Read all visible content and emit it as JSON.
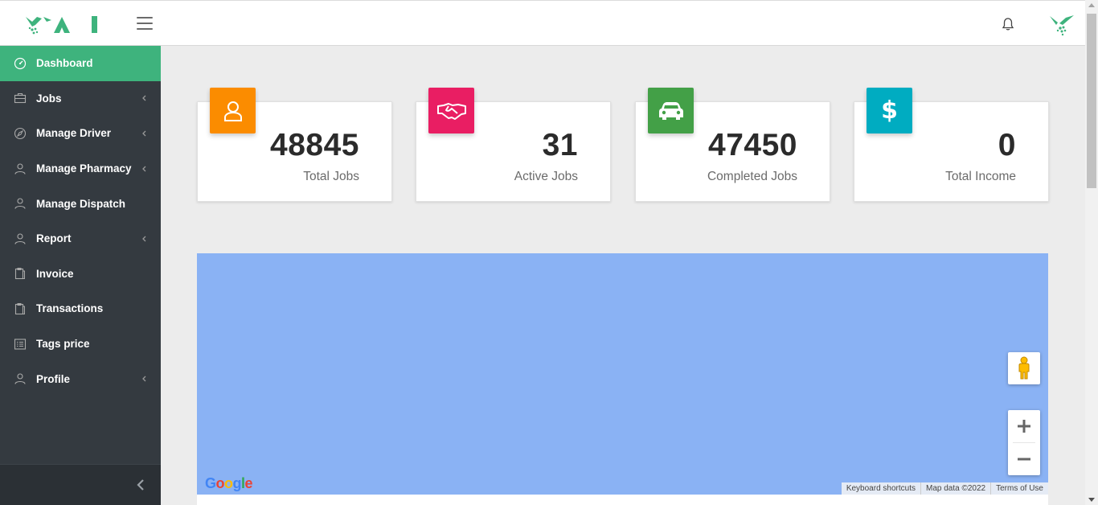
{
  "header": {
    "logo_text": "YAI",
    "menu_icon": "hamburger-icon",
    "notification_icon": "bell-icon",
    "avatar_icon": "brand-logo-icon"
  },
  "sidebar": {
    "items": [
      {
        "label": "Dashboard",
        "icon": "speedometer-icon",
        "active": true,
        "has_submenu": false
      },
      {
        "label": "Jobs",
        "icon": "briefcase-icon",
        "active": false,
        "has_submenu": true
      },
      {
        "label": "Manage Driver",
        "icon": "compass-icon",
        "active": false,
        "has_submenu": true
      },
      {
        "label": "Manage Pharmacy",
        "icon": "user-icon",
        "active": false,
        "has_submenu": true
      },
      {
        "label": "Manage Dispatch",
        "icon": "user-icon",
        "active": false,
        "has_submenu": false
      },
      {
        "label": "Report",
        "icon": "user-icon",
        "active": false,
        "has_submenu": true
      },
      {
        "label": "Invoice",
        "icon": "clipboard-icon",
        "active": false,
        "has_submenu": false
      },
      {
        "label": "Transactions",
        "icon": "clipboard-icon",
        "active": false,
        "has_submenu": false
      },
      {
        "label": "Tags price",
        "icon": "list-icon",
        "active": false,
        "has_submenu": false
      },
      {
        "label": "Profile",
        "icon": "user-icon",
        "active": false,
        "has_submenu": true
      }
    ],
    "collapse_icon": "chevron-left-icon"
  },
  "stats": [
    {
      "value": "48845",
      "label": "Total Jobs",
      "icon": "user-icon",
      "color": "#fb8c00"
    },
    {
      "value": "31",
      "label": "Active Jobs",
      "icon": "handshake-icon",
      "color": "#e91e63"
    },
    {
      "value": "47450",
      "label": "Completed Jobs",
      "icon": "car-icon",
      "color": "#43a047"
    },
    {
      "value": "0",
      "label": "Total Income",
      "icon": "dollar-icon",
      "color": "#00acc1"
    }
  ],
  "map": {
    "google_logo": "Google",
    "attribution": [
      "Keyboard shortcuts",
      "Map data ©2022",
      "Terms of Use"
    ],
    "background_color": "#8ab2f4"
  },
  "colors": {
    "accent": "#3eb37d",
    "sidebar_bg": "#343a40"
  }
}
